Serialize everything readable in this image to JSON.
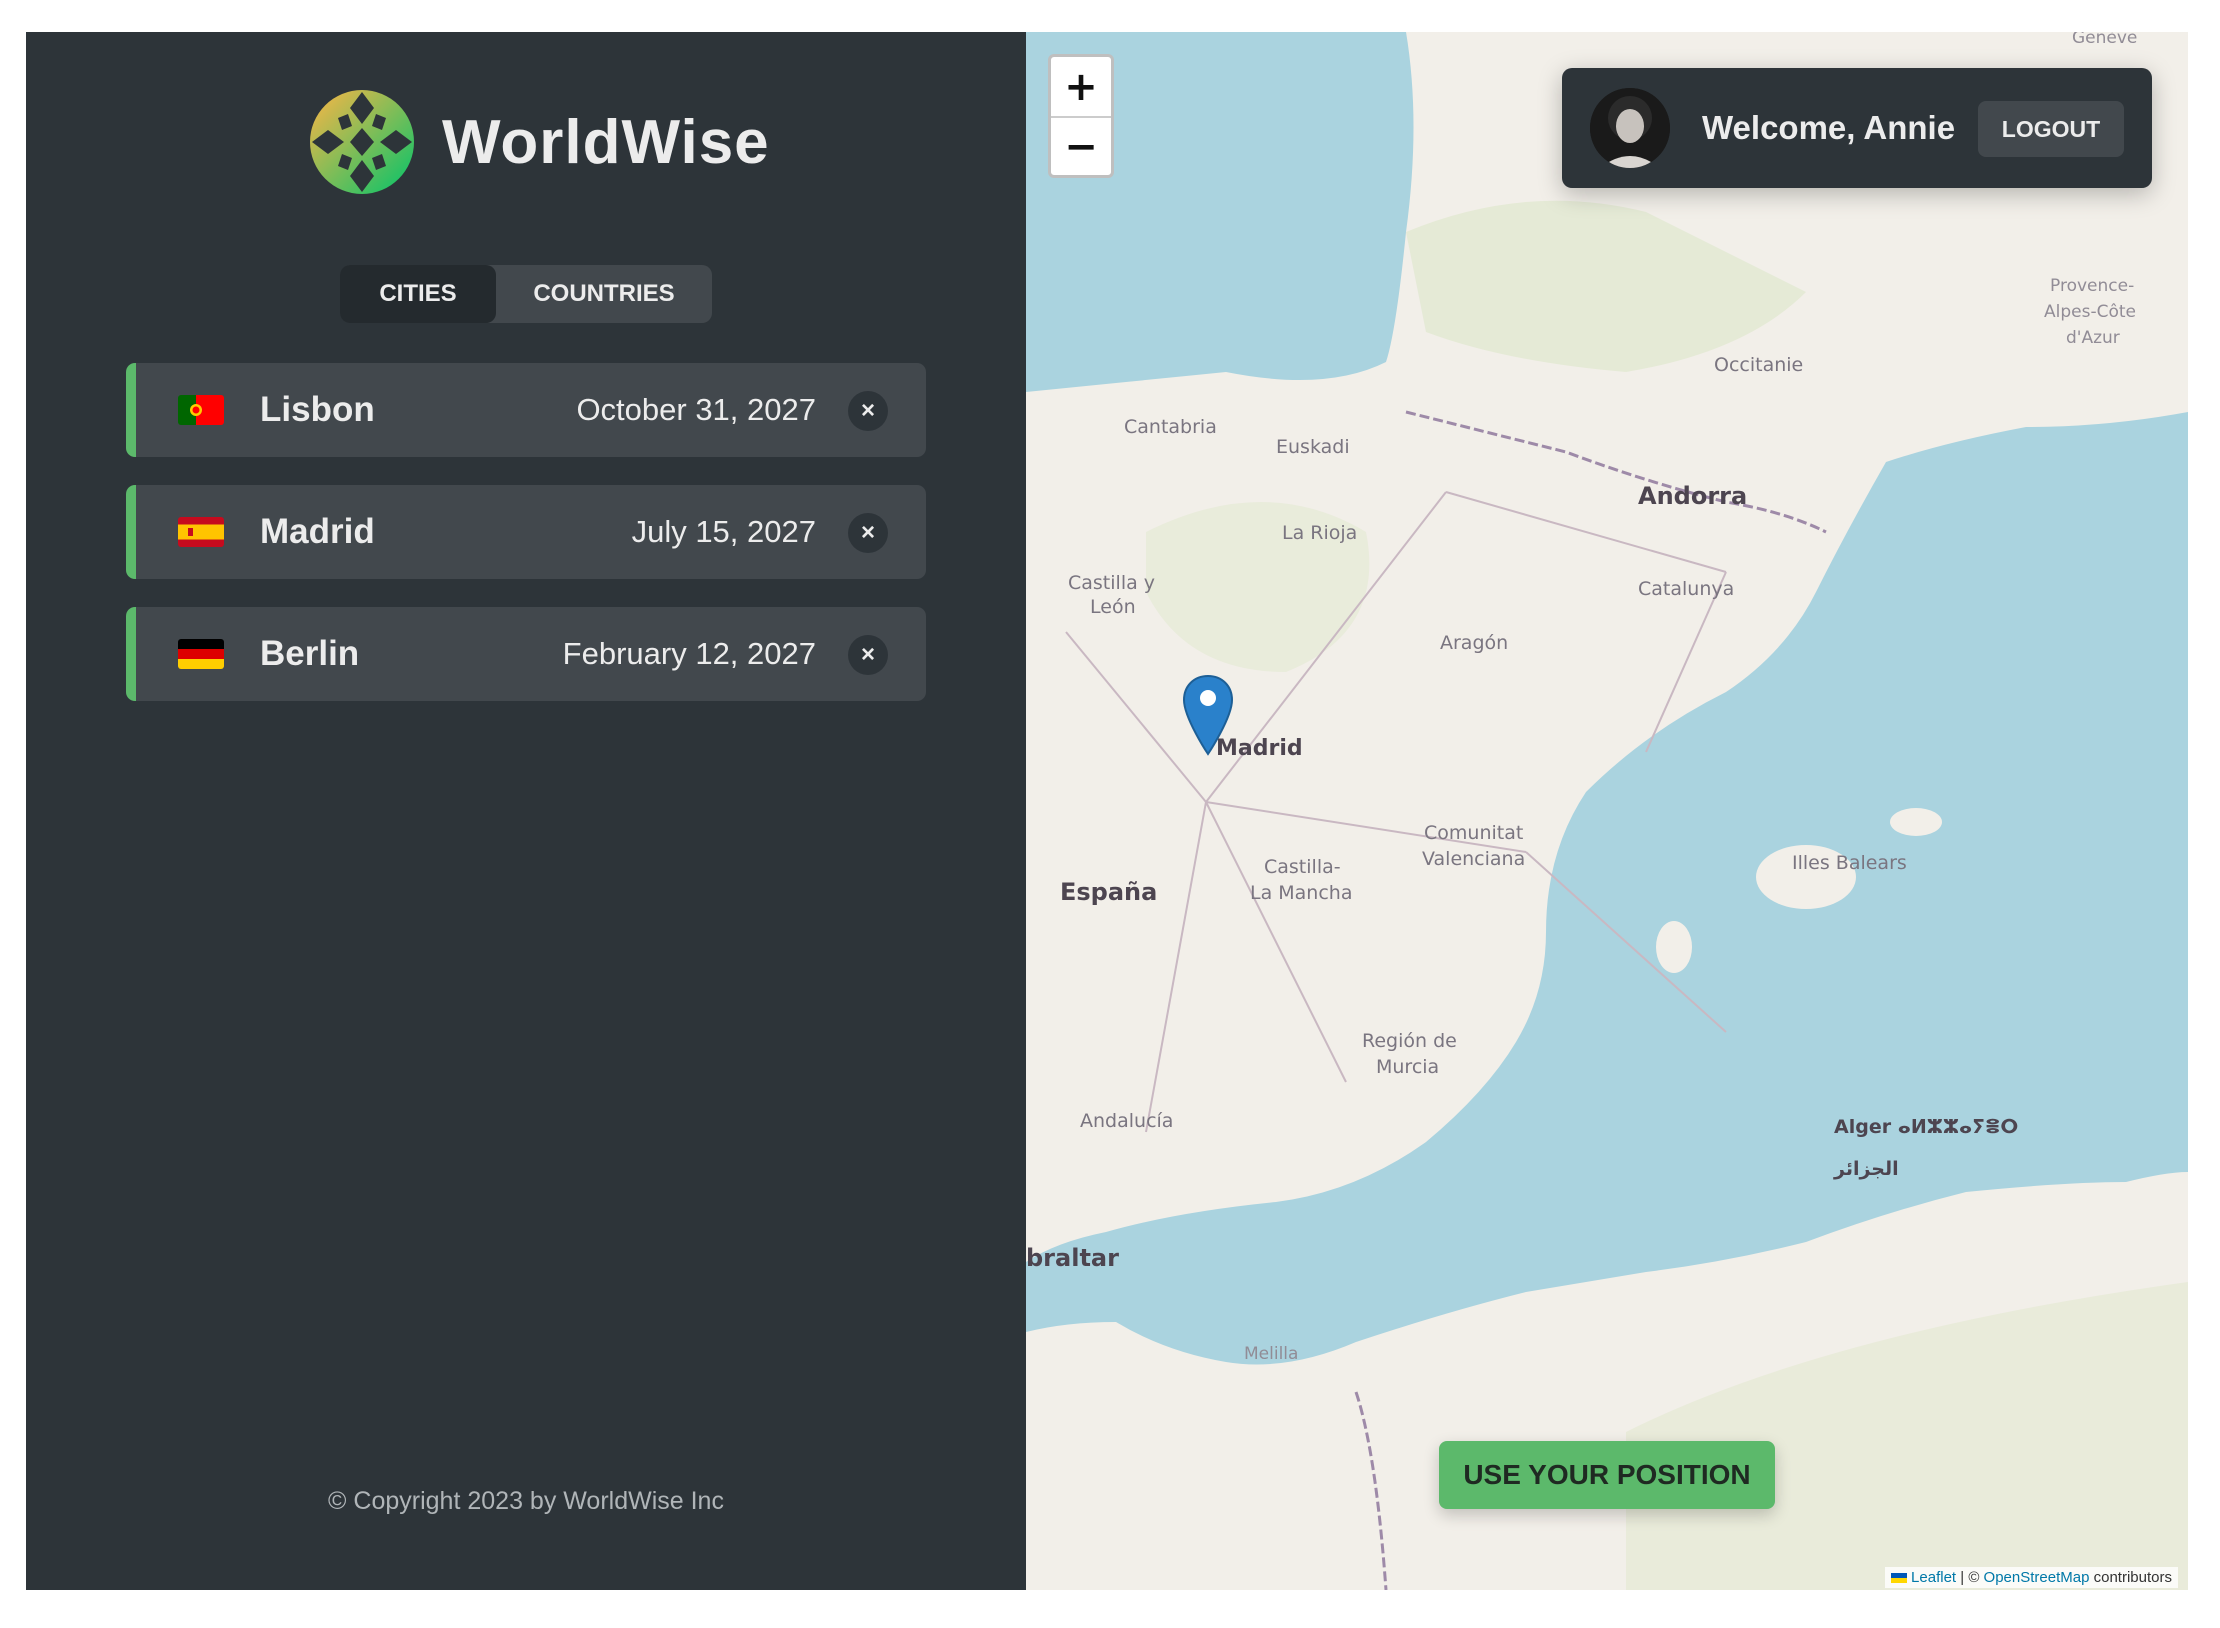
{
  "app": {
    "name": "WorldWise"
  },
  "tabs": [
    {
      "label": "CITIES",
      "active": true
    },
    {
      "label": "COUNTRIES",
      "active": false
    }
  ],
  "cities": [
    {
      "name": "Lisbon",
      "date": "October 31, 2027",
      "flag": "portugal-flag",
      "delete_label": "×"
    },
    {
      "name": "Madrid",
      "date": "July 15, 2027",
      "flag": "spain-flag",
      "delete_label": "×"
    },
    {
      "name": "Berlin",
      "date": "February 12, 2027",
      "flag": "germany-flag",
      "delete_label": "×"
    }
  ],
  "footer": {
    "copyright": "© Copyright 2023 by WorldWise Inc"
  },
  "map": {
    "zoom_in": "+",
    "zoom_out": "−",
    "labels": {
      "andorra": "Andorra",
      "espana": "España",
      "madrid": "Madrid",
      "cantabria": "Cantabria",
      "euskadi": "Euskadi",
      "la_rioja": "La Rioja",
      "castilla_leon_1": "Castilla y",
      "castilla_leon_2": "León",
      "aragon": "Aragón",
      "catalunya": "Catalunya",
      "occitanie": "Occitanie",
      "provence_1": "Provence-",
      "provence_2": "Alpes-Côte",
      "provence_3": "d'Azur",
      "comunitat_1": "Comunitat",
      "comunitat_2": "Valenciana",
      "castilla_mancha_1": "Castilla-",
      "castilla_mancha_2": "La Mancha",
      "illes_balears": "Illes Balears",
      "region_murcia_1": "Región de",
      "region_murcia_2": "Murcia",
      "andalucia": "Andalucía",
      "gibraltar": "braltar",
      "melilla": "Melilla",
      "alger": "Alger ⴰⵍⵣⵣⴰⵢⴻⵔ",
      "alger_ar": "الجزائر",
      "geneve": "Genève"
    },
    "marker": {
      "city": "Madrid",
      "icon": "map-pin-icon",
      "color": "#2a81cb"
    },
    "attribution": {
      "leaflet": "Leaflet",
      "separator": " | © ",
      "osm": "OpenStreetMap",
      "suffix": " contributors"
    }
  },
  "user": {
    "welcome": "Welcome, Annie",
    "logout": "LOGOUT",
    "avatar": "avatar"
  },
  "actions": {
    "use_position": "USE YOUR POSITION"
  },
  "colors": {
    "accent": "#5cb96b",
    "panel": "#2d3439",
    "card": "#42484d",
    "sea": "#aad3df",
    "land": "#f2efe9"
  }
}
